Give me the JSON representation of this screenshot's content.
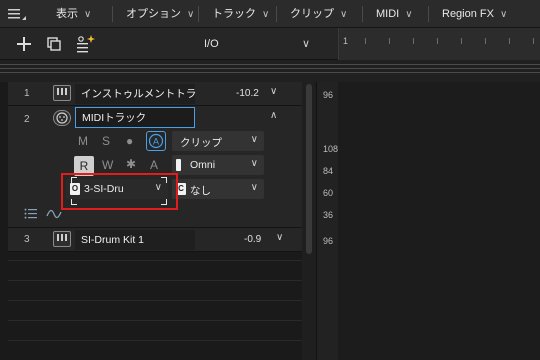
{
  "menubar": {
    "items": [
      {
        "label": "表示"
      },
      {
        "label": "オプション"
      },
      {
        "label": "トラック"
      },
      {
        "label": "クリップ"
      },
      {
        "label": "MIDI"
      },
      {
        "label": "Region FX"
      }
    ]
  },
  "toolbar": {
    "io_label": "I/O",
    "ruler_start": "1"
  },
  "levels": [
    "96",
    "108",
    "84",
    "60",
    "36",
    "96"
  ],
  "tracks": [
    {
      "number": "1",
      "name": "インストゥルメントトラック",
      "volume": "-10.2"
    },
    {
      "number": "2",
      "name": "MIDIトラック",
      "controls": {
        "mute": "M",
        "solo": "S",
        "record_dot": "●",
        "automation": "A",
        "r": "R",
        "w": "W",
        "star": "✱",
        "a": "A"
      },
      "clip_dropdown": "クリップ",
      "input_dropdown": "Omni",
      "output_dropdown": "3-SI-Dru",
      "channel_dropdown": "なし"
    },
    {
      "number": "3",
      "name": "SI-Drum Kit 1",
      "volume": "-0.9"
    }
  ]
}
